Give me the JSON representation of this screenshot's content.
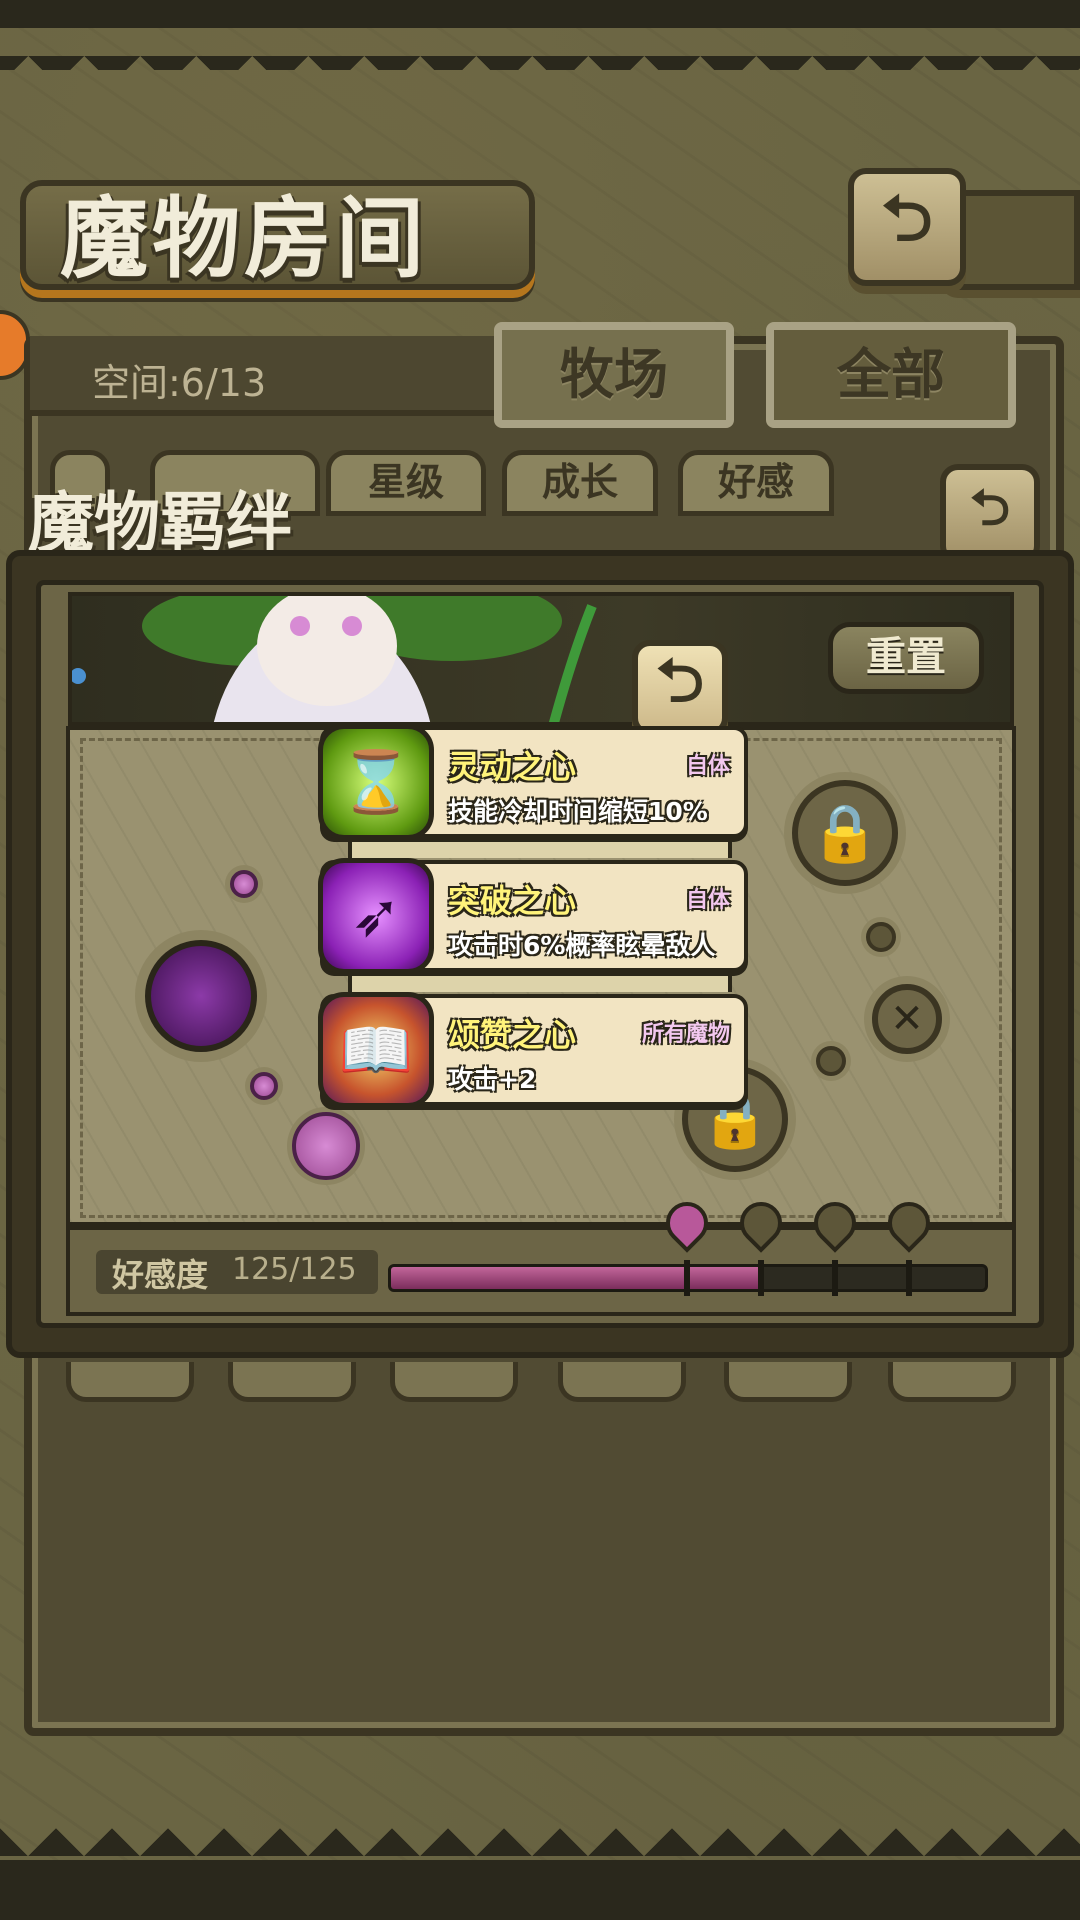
{
  "header": {
    "title": "魔物房间"
  },
  "room": {
    "space_label": "空间:6/13",
    "tabs": [
      {
        "label": "牧场"
      },
      {
        "label": "全部"
      }
    ],
    "filters": [
      {
        "label": "星级"
      },
      {
        "label": "成长"
      },
      {
        "label": "好感"
      }
    ]
  },
  "bond": {
    "title": "魔物羁绊",
    "reset_label": "重置",
    "skills": [
      {
        "name": "灵动之心",
        "scope": "自体",
        "desc": "技能冷却时间缩短10%",
        "icon": "hourglass-icon"
      },
      {
        "name": "突破之心",
        "scope": "自体",
        "desc": "攻击时6%概率眩晕敌人",
        "icon": "arrows-icon"
      },
      {
        "name": "颂赞之心",
        "scope": "所有魔物",
        "desc": "攻击+2",
        "icon": "book-icon"
      }
    ],
    "affinity": {
      "label": "好感度",
      "value": "125/125",
      "fill": 0.62
    }
  },
  "colors": {
    "accent": "#b8589a",
    "panel": "#6c6546",
    "outline": "#2a2619"
  }
}
